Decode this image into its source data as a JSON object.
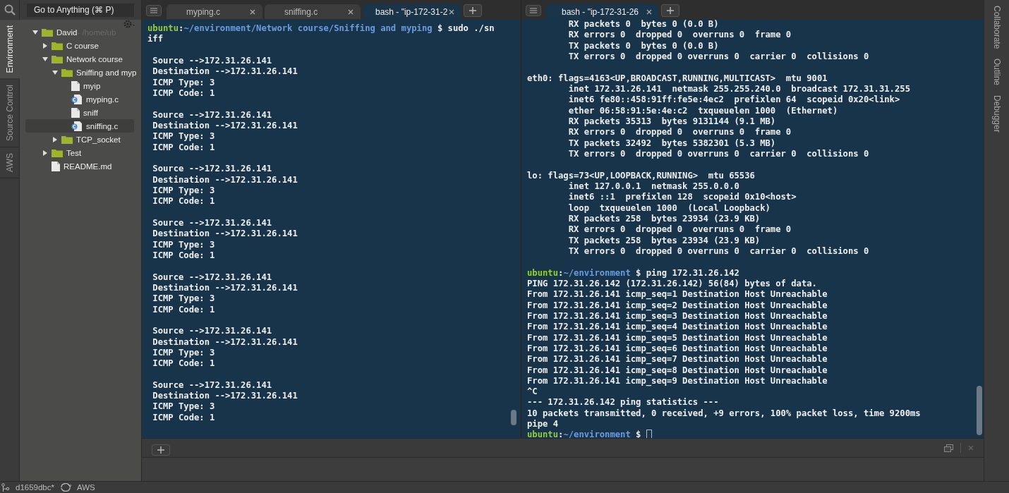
{
  "left_rail": {
    "tabs": [
      {
        "label": "Environment",
        "selected": true
      },
      {
        "label": "Source Control",
        "selected": false
      },
      {
        "label": "AWS",
        "selected": false
      }
    ]
  },
  "goto": {
    "placeholder": "Go to Anything (⌘ P)"
  },
  "tree": [
    {
      "name": "David",
      "suffix": " - /home/ub",
      "kind": "folder",
      "expanded": true,
      "selected": false,
      "children": [
        {
          "name": "C course",
          "kind": "folder",
          "expanded": false,
          "selected": false
        },
        {
          "name": "Network course",
          "kind": "folder",
          "expanded": true,
          "selected": false,
          "children": [
            {
              "name": "Sniffing and myp",
              "kind": "folder",
              "expanded": true,
              "selected": false,
              "children": [
                {
                  "name": "myip",
                  "kind": "file",
                  "selected": false
                },
                {
                  "name": "myping.c",
                  "kind": "cfile",
                  "selected": false
                },
                {
                  "name": "sniff",
                  "kind": "file",
                  "selected": false
                },
                {
                  "name": "sniffing.c",
                  "kind": "cfile",
                  "selected": true
                }
              ]
            },
            {
              "name": "TCP_socket",
              "kind": "folder",
              "expanded": false,
              "selected": false
            }
          ]
        },
        {
          "name": "Test",
          "kind": "folder",
          "expanded": false,
          "selected": false
        },
        {
          "name": "README.md",
          "kind": "file",
          "selected": false
        }
      ]
    }
  ],
  "panes": [
    {
      "tabs": [
        {
          "label": "myping.c",
          "selected": false
        },
        {
          "label": "sniffing.c",
          "selected": false
        },
        {
          "label": "bash - \"ip-172-31-2",
          "selected": true
        }
      ],
      "terminal": [
        {
          "kind": "prompt",
          "user": "ubuntu",
          "sep": ":",
          "path": "~/environment/Network course/Sniffing and myping",
          "command": " $ sudo ./sn"
        },
        {
          "kind": "text",
          "text": "iff"
        },
        {
          "kind": "blank"
        },
        {
          "kind": "text",
          "text": " Source -->172.31.26.141"
        },
        {
          "kind": "text",
          "text": " Destination -->172.31.26.141"
        },
        {
          "kind": "text",
          "text": " ICMP Type: 3"
        },
        {
          "kind": "text",
          "text": " ICMP Code: 1"
        },
        {
          "kind": "blank"
        },
        {
          "kind": "text",
          "text": " Source -->172.31.26.141"
        },
        {
          "kind": "text",
          "text": " Destination -->172.31.26.141"
        },
        {
          "kind": "text",
          "text": " ICMP Type: 3"
        },
        {
          "kind": "text",
          "text": " ICMP Code: 1"
        },
        {
          "kind": "blank"
        },
        {
          "kind": "text",
          "text": " Source -->172.31.26.141"
        },
        {
          "kind": "text",
          "text": " Destination -->172.31.26.141"
        },
        {
          "kind": "text",
          "text": " ICMP Type: 3"
        },
        {
          "kind": "text",
          "text": " ICMP Code: 1"
        },
        {
          "kind": "blank"
        },
        {
          "kind": "text",
          "text": " Source -->172.31.26.141"
        },
        {
          "kind": "text",
          "text": " Destination -->172.31.26.141"
        },
        {
          "kind": "text",
          "text": " ICMP Type: 3"
        },
        {
          "kind": "text",
          "text": " ICMP Code: 1"
        },
        {
          "kind": "blank"
        },
        {
          "kind": "text",
          "text": " Source -->172.31.26.141"
        },
        {
          "kind": "text",
          "text": " Destination -->172.31.26.141"
        },
        {
          "kind": "text",
          "text": " ICMP Type: 3"
        },
        {
          "kind": "text",
          "text": " ICMP Code: 1"
        },
        {
          "kind": "blank"
        },
        {
          "kind": "text",
          "text": " Source -->172.31.26.141"
        },
        {
          "kind": "text",
          "text": " Destination -->172.31.26.141"
        },
        {
          "kind": "text",
          "text": " ICMP Type: 3"
        },
        {
          "kind": "text",
          "text": " ICMP Code: 1"
        },
        {
          "kind": "blank"
        },
        {
          "kind": "text",
          "text": " Source -->172.31.26.141"
        },
        {
          "kind": "text",
          "text": " Destination -->172.31.26.141"
        },
        {
          "kind": "text",
          "text": " ICMP Type: 3"
        },
        {
          "kind": "text",
          "text": " ICMP Code: 1"
        }
      ]
    },
    {
      "tabs": [
        {
          "label": "bash - \"ip-172-31-26",
          "selected": true
        }
      ],
      "terminal": [
        {
          "kind": "text",
          "text": "        RX packets 0  bytes 0 (0.0 B)"
        },
        {
          "kind": "text",
          "text": "        RX errors 0  dropped 0  overruns 0  frame 0"
        },
        {
          "kind": "text",
          "text": "        TX packets 0  bytes 0 (0.0 B)"
        },
        {
          "kind": "text",
          "text": "        TX errors 0  dropped 0 overruns 0  carrier 0  collisions 0"
        },
        {
          "kind": "blank"
        },
        {
          "kind": "text",
          "text": "eth0: flags=4163<UP,BROADCAST,RUNNING,MULTICAST>  mtu 9001"
        },
        {
          "kind": "text",
          "text": "        inet 172.31.26.141  netmask 255.255.240.0  broadcast 172.31.31.255"
        },
        {
          "kind": "text",
          "text": "        inet6 fe80::458:91ff:fe5e:4ec2  prefixlen 64  scopeid 0x20<link>"
        },
        {
          "kind": "text",
          "text": "        ether 06:58:91:5e:4e:c2  txqueuelen 1000  (Ethernet)"
        },
        {
          "kind": "text",
          "text": "        RX packets 35313  bytes 9131144 (9.1 MB)"
        },
        {
          "kind": "text",
          "text": "        RX errors 0  dropped 0  overruns 0  frame 0"
        },
        {
          "kind": "text",
          "text": "        TX packets 32492  bytes 5382301 (5.3 MB)"
        },
        {
          "kind": "text",
          "text": "        TX errors 0  dropped 0 overruns 0  carrier 0  collisions 0"
        },
        {
          "kind": "blank"
        },
        {
          "kind": "text",
          "text": "lo: flags=73<UP,LOOPBACK,RUNNING>  mtu 65536"
        },
        {
          "kind": "text",
          "text": "        inet 127.0.0.1  netmask 255.0.0.0"
        },
        {
          "kind": "text",
          "text": "        inet6 ::1  prefixlen 128  scopeid 0x10<host>"
        },
        {
          "kind": "text",
          "text": "        loop  txqueuelen 1000  (Local Loopback)"
        },
        {
          "kind": "text",
          "text": "        RX packets 258  bytes 23934 (23.9 KB)"
        },
        {
          "kind": "text",
          "text": "        RX errors 0  dropped 0  overruns 0  frame 0"
        },
        {
          "kind": "text",
          "text": "        TX packets 258  bytes 23934 (23.9 KB)"
        },
        {
          "kind": "text",
          "text": "        TX errors 0  dropped 0 overruns 0  carrier 0  collisions 0"
        },
        {
          "kind": "blank"
        },
        {
          "kind": "prompt",
          "user": "ubuntu",
          "sep": ":",
          "path": "~/environment",
          "command": " $ ping 172.31.26.142"
        },
        {
          "kind": "text",
          "text": "PING 172.31.26.142 (172.31.26.142) 56(84) bytes of data."
        },
        {
          "kind": "text",
          "text": "From 172.31.26.141 icmp_seq=1 Destination Host Unreachable"
        },
        {
          "kind": "text",
          "text": "From 172.31.26.141 icmp_seq=2 Destination Host Unreachable"
        },
        {
          "kind": "text",
          "text": "From 172.31.26.141 icmp_seq=3 Destination Host Unreachable"
        },
        {
          "kind": "text",
          "text": "From 172.31.26.141 icmp_seq=4 Destination Host Unreachable"
        },
        {
          "kind": "text",
          "text": "From 172.31.26.141 icmp_seq=5 Destination Host Unreachable"
        },
        {
          "kind": "text",
          "text": "From 172.31.26.141 icmp_seq=6 Destination Host Unreachable"
        },
        {
          "kind": "text",
          "text": "From 172.31.26.141 icmp_seq=7 Destination Host Unreachable"
        },
        {
          "kind": "text",
          "text": "From 172.31.26.141 icmp_seq=8 Destination Host Unreachable"
        },
        {
          "kind": "text",
          "text": "From 172.31.26.141 icmp_seq=9 Destination Host Unreachable"
        },
        {
          "kind": "text",
          "text": "^C"
        },
        {
          "kind": "text",
          "text": "--- 172.31.26.142 ping statistics ---"
        },
        {
          "kind": "text",
          "text": "10 packets transmitted, 0 received, +9 errors, 100% packet loss, time 9200ms"
        },
        {
          "kind": "text",
          "text": "pipe 4"
        },
        {
          "kind": "prompt",
          "user": "ubuntu",
          "sep": ":",
          "path": "~/environment",
          "command": " $ ",
          "cursor": true
        }
      ]
    }
  ],
  "right_rail": {
    "tabs": [
      {
        "label": "Collaborate",
        "selected": false
      },
      {
        "label": "Outline",
        "selected": false
      },
      {
        "label": "Debugger",
        "selected": false
      }
    ]
  },
  "status_bar": {
    "branch": "d1659dbc*",
    "region": "AWS"
  }
}
